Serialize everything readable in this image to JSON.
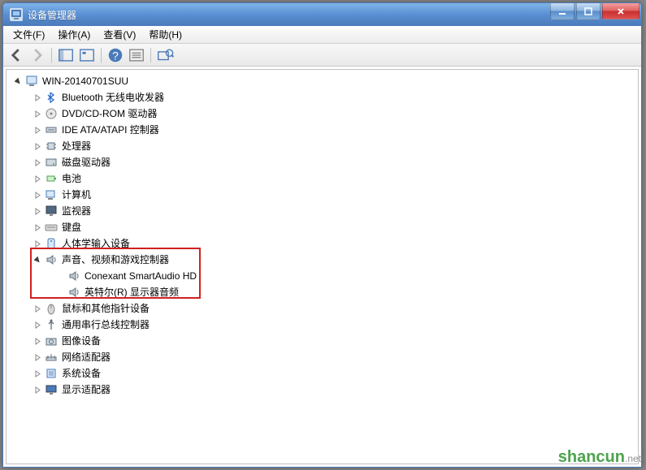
{
  "window": {
    "title": "设备管理器"
  },
  "menu": {
    "file": "文件(F)",
    "action": "操作(A)",
    "view": "查看(V)",
    "help": "帮助(H)"
  },
  "tree": {
    "root": "WIN-20140701SUU",
    "items": [
      {
        "label": "Bluetooth 无线电收发器",
        "icon": "bluetooth"
      },
      {
        "label": "DVD/CD-ROM 驱动器",
        "icon": "disc"
      },
      {
        "label": "IDE ATA/ATAPI 控制器",
        "icon": "ide"
      },
      {
        "label": "处理器",
        "icon": "cpu"
      },
      {
        "label": "磁盘驱动器",
        "icon": "disk"
      },
      {
        "label": "电池",
        "icon": "battery"
      },
      {
        "label": "计算机",
        "icon": "computer"
      },
      {
        "label": "监视器",
        "icon": "monitor"
      },
      {
        "label": "键盘",
        "icon": "keyboard"
      },
      {
        "label": "人体学输入设备",
        "icon": "hid"
      },
      {
        "label": "声音、视频和游戏控制器",
        "icon": "audio",
        "expanded": true,
        "children": [
          {
            "label": "Conexant SmartAudio HD",
            "icon": "speaker"
          },
          {
            "label": "英特尔(R) 显示器音频",
            "icon": "speaker"
          }
        ]
      },
      {
        "label": "鼠标和其他指针设备",
        "icon": "mouse"
      },
      {
        "label": "通用串行总线控制器",
        "icon": "usb"
      },
      {
        "label": "图像设备",
        "icon": "camera"
      },
      {
        "label": "网络适配器",
        "icon": "network"
      },
      {
        "label": "系统设备",
        "icon": "system"
      },
      {
        "label": "显示适配器",
        "icon": "display"
      }
    ]
  },
  "watermark": {
    "main": "shancun",
    "sub": ".net"
  }
}
